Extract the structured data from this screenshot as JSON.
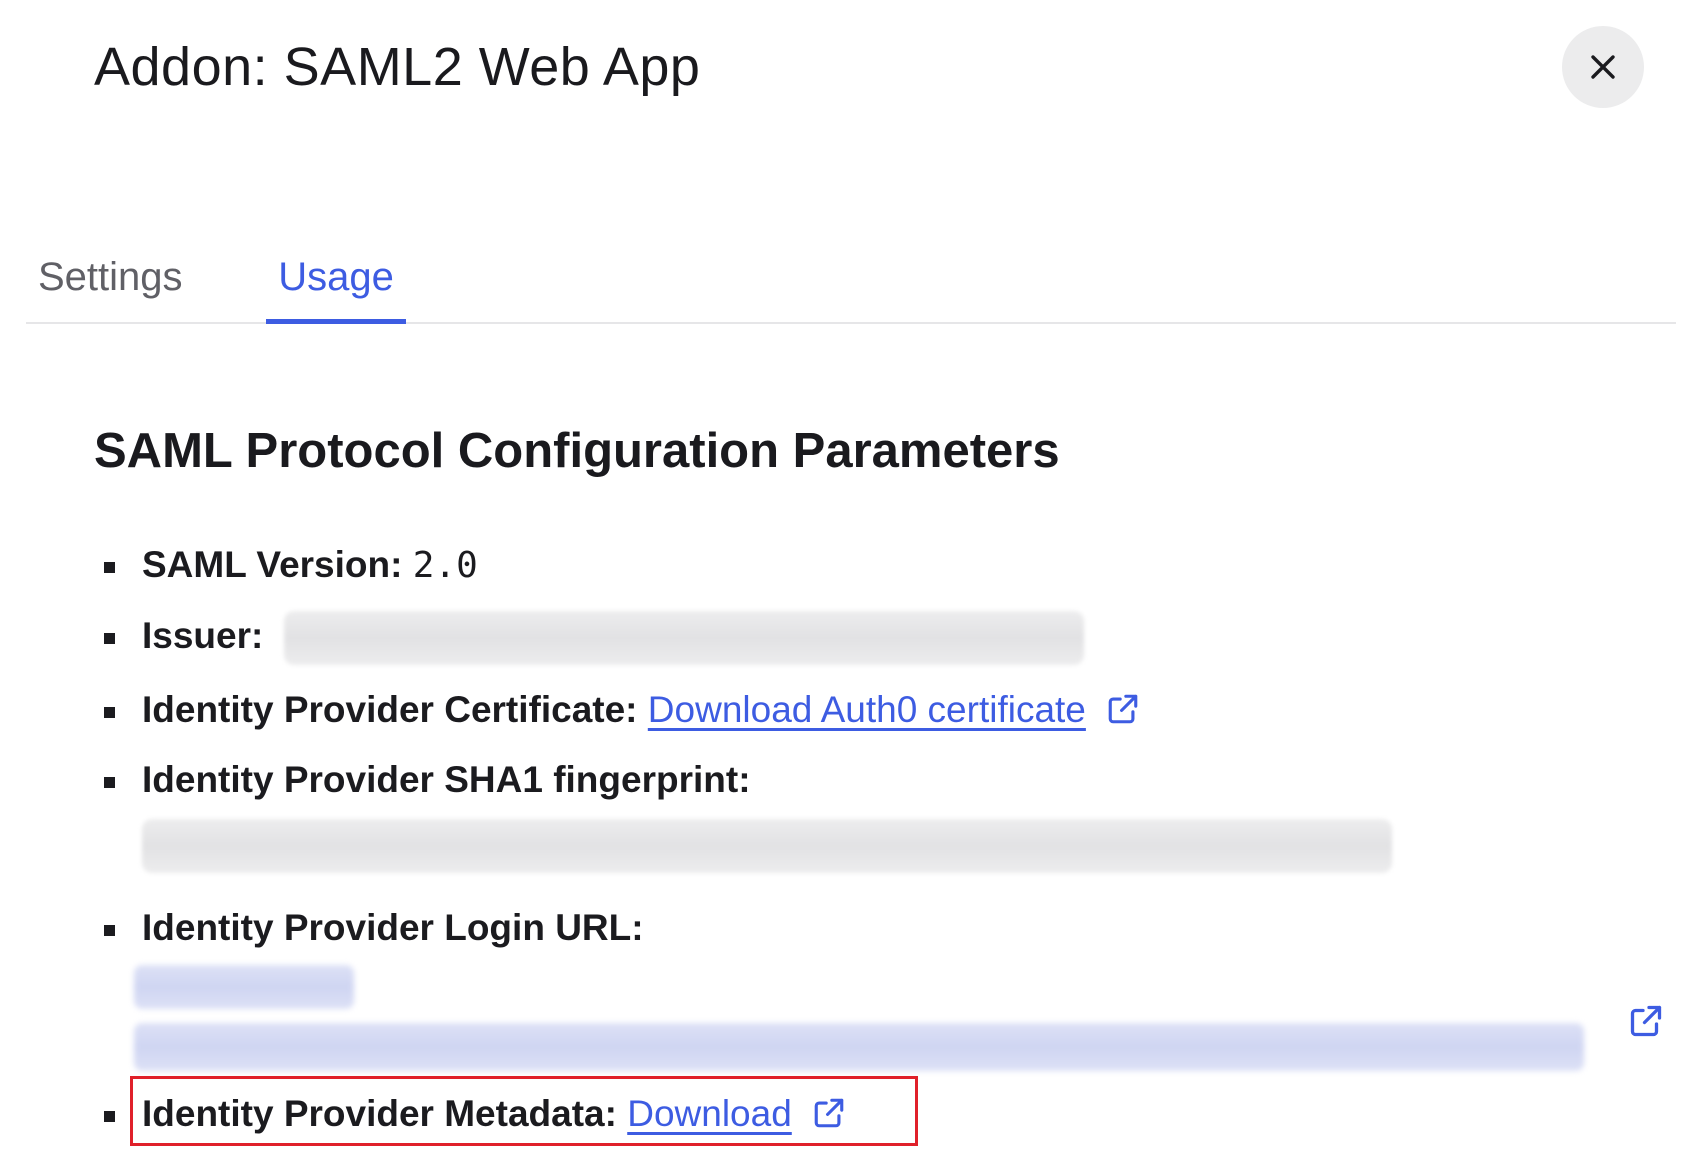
{
  "modal": {
    "title": "Addon: SAML2 Web App",
    "close_icon": "close-icon"
  },
  "tabs": [
    {
      "label": "Settings",
      "active": false
    },
    {
      "label": "Usage",
      "active": true
    }
  ],
  "section": {
    "heading": "SAML Protocol Configuration Parameters"
  },
  "params": {
    "saml_version": {
      "label": "SAML Version:",
      "value": "2.0"
    },
    "issuer": {
      "label": "Issuer:"
    },
    "certificate": {
      "label": "Identity Provider Certificate:",
      "link_text": "Download Auth0 certificate",
      "icon": "external-link-icon"
    },
    "sha1": {
      "label": "Identity Provider SHA1 fingerprint:"
    },
    "login_url": {
      "label": "Identity Provider Login URL:",
      "icon": "external-link-icon"
    },
    "metadata": {
      "label": "Identity Provider Metadata:",
      "link_text": "Download",
      "icon": "external-link-icon"
    }
  },
  "colors": {
    "accent": "#3d5ce2",
    "highlight": "#e0202a",
    "text": "#1b1b1f"
  }
}
